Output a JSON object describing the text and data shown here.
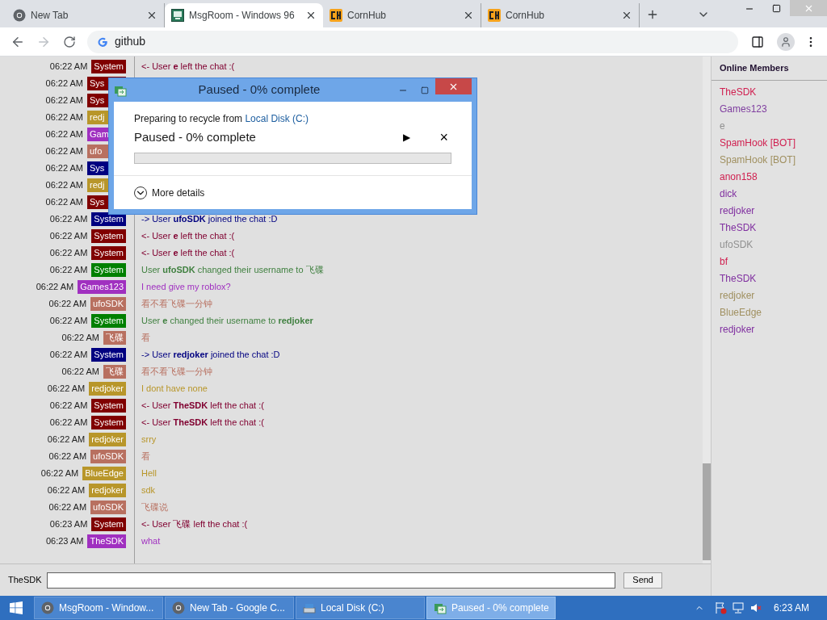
{
  "browser": {
    "tabs": [
      {
        "title": "New Tab",
        "kind": "chrome",
        "selected": false
      },
      {
        "title": "MsgRoom - Windows 96",
        "kind": "msgroom",
        "selected": true
      },
      {
        "title": "CornHub",
        "kind": "ch",
        "selected": false
      },
      {
        "title": "CornHub",
        "kind": "ch",
        "selected": false
      }
    ],
    "address": "github"
  },
  "chat": {
    "messages": [
      {
        "time": "06:22 AM",
        "name": "System",
        "color": "#800000",
        "kind": "leave",
        "text": "<- User **e** left the chat :("
      },
      {
        "time": "06:22 AM",
        "name": "Sys",
        "color": "#800000",
        "covered": true
      },
      {
        "time": "06:22 AM",
        "name": "Sys",
        "color": "#800000",
        "covered": true
      },
      {
        "time": "06:22 AM",
        "name": "redj",
        "color": "#b8962a",
        "covered": true
      },
      {
        "time": "06:22 AM",
        "name": "Gam",
        "color": "#a030c0",
        "covered": true
      },
      {
        "time": "06:22 AM",
        "name": "ufo",
        "color": "#b87060",
        "covered": true
      },
      {
        "time": "06:22 AM",
        "name": "Sys",
        "color": "#000080",
        "covered": true
      },
      {
        "time": "06:22 AM",
        "name": "redj",
        "color": "#b8962a",
        "covered": true
      },
      {
        "time": "06:22 AM",
        "name": "Sys",
        "color": "#800000",
        "covered": true
      },
      {
        "time": "06:22 AM",
        "name": "System",
        "color": "#000080",
        "kind": "join",
        "text": "-> User **ufoSDK** joined the chat :D"
      },
      {
        "time": "06:22 AM",
        "name": "System",
        "color": "#800000",
        "kind": "leave",
        "text": "<- User **e** left the chat :("
      },
      {
        "time": "06:22 AM",
        "name": "System",
        "color": "#800000",
        "kind": "leave",
        "text": "<- User **e** left the chat :("
      },
      {
        "time": "06:22 AM",
        "name": "System",
        "color": "#008000",
        "kind": "rename",
        "text": "User **ufoSDK** changed their username to 飞碟"
      },
      {
        "time": "06:22 AM",
        "name": "Games123",
        "color": "#a030c0",
        "kind": "chat",
        "text": "I need give my roblox?"
      },
      {
        "time": "06:22 AM",
        "name": "ufoSDK",
        "color": "#b87060",
        "kind": "chat",
        "text": "看不看飞碟一分钟"
      },
      {
        "time": "06:22 AM",
        "name": "System",
        "color": "#008000",
        "kind": "rename",
        "text": "User **e** changed their username to **redjoker**"
      },
      {
        "time": "06:22 AM",
        "name": "飞碟",
        "color": "#b87060",
        "kind": "chat",
        "text": "看"
      },
      {
        "time": "06:22 AM",
        "name": "System",
        "color": "#000080",
        "kind": "join",
        "text": "-> User **redjoker** joined the chat :D"
      },
      {
        "time": "06:22 AM",
        "name": "飞碟",
        "color": "#b87060",
        "kind": "chat",
        "text": "看不看飞碟一分钟"
      },
      {
        "time": "06:22 AM",
        "name": "redjoker",
        "color": "#b8962a",
        "kind": "chat",
        "text": "I dont have none"
      },
      {
        "time": "06:22 AM",
        "name": "System",
        "color": "#800000",
        "kind": "leave",
        "text": "<- User **TheSDK** left the chat :("
      },
      {
        "time": "06:22 AM",
        "name": "System",
        "color": "#800000",
        "kind": "leave",
        "text": "<- User **TheSDK** left the chat :("
      },
      {
        "time": "06:22 AM",
        "name": "redjoker",
        "color": "#b8962a",
        "kind": "chat",
        "text": "srry"
      },
      {
        "time": "06:22 AM",
        "name": "ufoSDK",
        "color": "#b87060",
        "kind": "chat",
        "text": "看"
      },
      {
        "time": "06:22 AM",
        "name": "BlueEdge",
        "color": "#b8962a",
        "kind": "chat",
        "text": "Hell"
      },
      {
        "time": "06:22 AM",
        "name": "redjoker",
        "color": "#b8962a",
        "kind": "chat",
        "text": "sdk"
      },
      {
        "time": "06:22 AM",
        "name": "ufoSDK",
        "color": "#b87060",
        "kind": "chat",
        "text": "飞碟说"
      },
      {
        "time": "06:23 AM",
        "name": "System",
        "color": "#800000",
        "kind": "leave",
        "text": "<- User 飞碟 left the chat :("
      },
      {
        "time": "06:23 AM",
        "name": "TheSDK",
        "color": "#a030c0",
        "kind": "chat",
        "text": "what"
      }
    ],
    "input_label": "TheSDK",
    "send": "Send"
  },
  "members": {
    "title": "Online Members",
    "items": [
      {
        "name": "TheSDK",
        "color": "#d02050"
      },
      {
        "name": "Games123",
        "color": "#8040a0"
      },
      {
        "name": "e",
        "color": "#909090"
      },
      {
        "name": "SpamHook [BOT]",
        "color": "#d02050"
      },
      {
        "name": "SpamHook [BOT]",
        "color": "#a09060"
      },
      {
        "name": "anon158",
        "color": "#d02050"
      },
      {
        "name": "dick",
        "color": "#8030a0"
      },
      {
        "name": "redjoker",
        "color": "#8030a0"
      },
      {
        "name": "TheSDK",
        "color": "#8030a0"
      },
      {
        "name": "ufoSDK",
        "color": "#909090"
      },
      {
        "name": "bf",
        "color": "#d02050"
      },
      {
        "name": "TheSDK",
        "color": "#8030a0"
      },
      {
        "name": "redjoker",
        "color": "#a09060"
      },
      {
        "name": "BlueEdge",
        "color": "#a09060"
      },
      {
        "name": "redjoker",
        "color": "#8030a0"
      }
    ]
  },
  "dialog": {
    "title": "Paused - 0% complete",
    "source_prefix": "Preparing to recycle from",
    "source_link": "Local Disk (C:)",
    "status": "Paused - 0% complete",
    "level": 0,
    "play": "▶",
    "cancel": "×",
    "details": "More details"
  },
  "taskbar": {
    "items": [
      {
        "label": "MsgRoom - Window...",
        "kind": "chrome",
        "selected": false
      },
      {
        "label": "New Tab - Google C...",
        "kind": "chrome",
        "selected": false
      },
      {
        "label": "Local Disk (C:)",
        "kind": "drive",
        "selected": false
      },
      {
        "label": "Paused - 0% complete",
        "kind": "copy",
        "selected": true
      }
    ],
    "clock": "6:23 AM"
  }
}
